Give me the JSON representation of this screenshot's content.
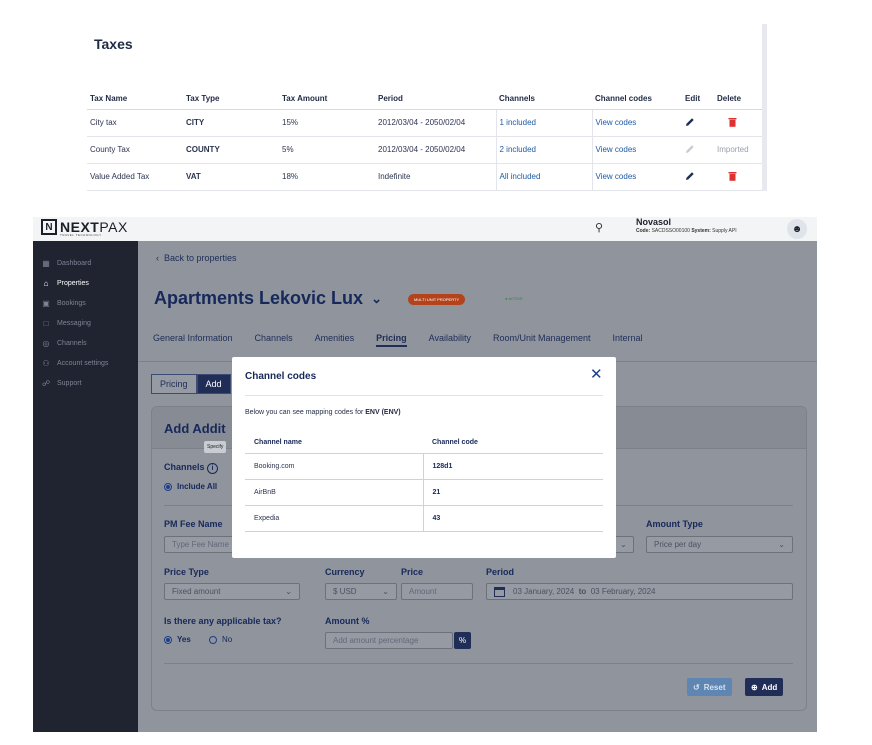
{
  "taxes": {
    "title": "Taxes",
    "columns": [
      "Tax Name",
      "Tax Type",
      "Tax Amount",
      "Period",
      "Channels",
      "Channel codes",
      "Edit",
      "Delete"
    ],
    "rows": [
      {
        "name": "City tax",
        "type": "CITY",
        "amount": "15%",
        "period": "2012/03/04 - 2050/02/04",
        "channels": "1 included",
        "codes": "View codes",
        "editable": true,
        "delete": "trash"
      },
      {
        "name": "County Tax",
        "type": "COUNTY",
        "amount": "5%",
        "period": "2012/03/04 - 2050/02/04",
        "channels": "2 included",
        "codes": "View codes",
        "editable": false,
        "delete": "Imported"
      },
      {
        "name": "Value Added Tax",
        "type": "VAT",
        "amount": "18%",
        "period": "Indefinite",
        "channels": "All included",
        "codes": "View codes",
        "editable": true,
        "delete": "trash"
      }
    ]
  },
  "app": {
    "logo_main": "NEXT",
    "logo_light": "PAX",
    "logo_sub": "TRAVEL TECHNOLOGY",
    "user_name": "Novasol",
    "user_code_label": "Code:",
    "user_code": "SACDSSO00100",
    "user_system_label": "System:",
    "user_system": "Supply API",
    "nav": [
      {
        "label": "Dashboard",
        "icon": "grid-icon",
        "active": false
      },
      {
        "label": "Properties",
        "icon": "building-icon",
        "active": true
      },
      {
        "label": "Bookings",
        "icon": "calendar-icon",
        "active": false
      },
      {
        "label": "Messaging",
        "icon": "chat-icon",
        "active": false
      },
      {
        "label": "Channels",
        "icon": "globe-icon",
        "active": false
      },
      {
        "label": "Account settings",
        "icon": "users-icon",
        "active": false
      },
      {
        "label": "Support",
        "icon": "headset-icon",
        "active": false
      }
    ],
    "back_label": "Back to properties",
    "property_title": "Apartments Lekovic Lux",
    "badge_multi": "MULTI UNIT PROPERTY",
    "badge_active": "ACTIVE",
    "tabs": [
      "General Information",
      "Channels",
      "Amenities",
      "Pricing",
      "Availability",
      "Room/Unit Management",
      "Internal"
    ],
    "active_tab": "Pricing",
    "subtab_1": "Pricing",
    "subtab_2": "Add",
    "form_title": "Add Addit",
    "tooltip": "Specify",
    "channels_label": "Channels",
    "include_all": "Include All",
    "pm_fee_label": "PM Fee Name",
    "pm_fee_placeholder": "Type Fee Name",
    "amount_type_label": "Amount Type",
    "amount_type_value": "Price per day",
    "price_type_label": "Price Type",
    "price_type_value": "Fixed amount",
    "currency_label": "Currency",
    "currency_value": "$ USD",
    "price_label": "Price",
    "price_placeholder": "Amount",
    "period_label": "Period",
    "period_from": "03 January, 2024",
    "period_to_word": "to",
    "period_to": "03 February, 2024",
    "tax_q_label": "Is there any applicable tax?",
    "yes": "Yes",
    "no": "No",
    "amount_pct_label": "Amount %",
    "amount_pct_placeholder": "Add amount percentage",
    "pct_symbol": "%",
    "reset": "Reset",
    "add": "Add"
  },
  "modal": {
    "title": "Channel codes",
    "desc_prefix": "Below you can see mapping codes for",
    "desc_bold": "ENV (ENV)",
    "col_name": "Channel name",
    "col_code": "Channel code",
    "rows": [
      {
        "name": "Booking.com",
        "code": "128d1"
      },
      {
        "name": "AirBnB",
        "code": "21"
      },
      {
        "name": "Expedia",
        "code": "43"
      }
    ]
  }
}
